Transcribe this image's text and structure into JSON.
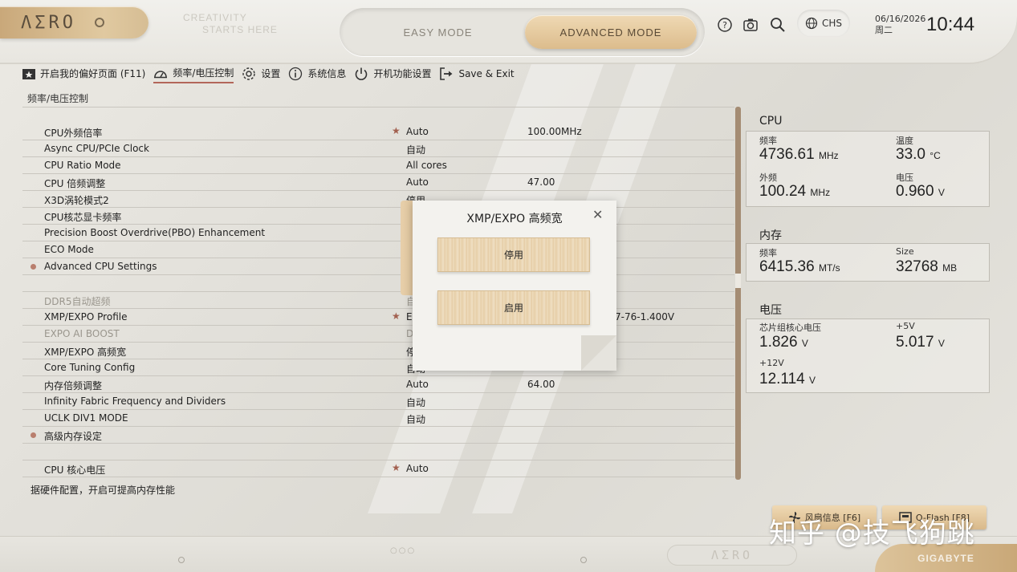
{
  "header": {
    "logo": "ΛΣRO",
    "tagline_line1": "CREATIVITY",
    "tagline_line2": "STARTS HERE",
    "easy_mode": "EASY MODE",
    "advanced_mode": "ADVANCED MODE",
    "language": "CHS",
    "date": "06/16/2026",
    "weekday": "周二",
    "time": "10:44"
  },
  "menu": {
    "favorites": "开启我的偏好页面 (F11)",
    "tweaker": "频率/电压控制",
    "settings": "设置",
    "system_info": "系统信息",
    "boot": "开机功能设置",
    "save_exit": "Save & Exit"
  },
  "breadcrumb": "频率/电压控制",
  "settings": {
    "rows": [
      {
        "name": "CPU外频倍率",
        "star": true,
        "value": "Auto",
        "value2": "100.00MHz"
      },
      {
        "name": "Async CPU/PCIe Clock",
        "value": "自动"
      },
      {
        "name": "CPU Ratio Mode",
        "value": "All cores"
      },
      {
        "name": "CPU 倍频调整",
        "value": "Auto",
        "value2": "47.00"
      },
      {
        "name": "X3D涡轮模式2",
        "value": "停用"
      },
      {
        "name": "CPU核芯显卡频率"
      },
      {
        "name": "Precision Boost Overdrive(PBO) Enhancement"
      },
      {
        "name": "ECO Mode"
      },
      {
        "name": "Advanced CPU Settings"
      },
      {
        "name": "DDR5自动超频",
        "value": "自"
      },
      {
        "name": "XMP/EXPO Profile",
        "star": true,
        "value": "EX",
        "value2": "7-76-1.400V"
      },
      {
        "name": "EXPO AI BOOST",
        "value": "D"
      },
      {
        "name": "XMP/EXPO 高频宽",
        "value": "停"
      },
      {
        "name": "Core Tuning Config",
        "value": "自动"
      },
      {
        "name": "内存倍频调整",
        "value": "Auto",
        "value2": "64.00"
      },
      {
        "name": "Infinity Fabric Frequency and Dividers",
        "value": "自动"
      },
      {
        "name": "UCLK DIV1 MODE",
        "value": "自动"
      },
      {
        "name": "高级内存设定"
      },
      {
        "name": "CPU 核心电压",
        "star": true,
        "value": "Auto"
      }
    ]
  },
  "help_text": "据硬件配置，开启可提高内存性能",
  "monitor": {
    "cpu": {
      "title": "CPU",
      "freq_label": "频率",
      "freq": "4736.61",
      "freq_unit": "MHz",
      "temp_label": "温度",
      "temp": "33.0",
      "temp_unit": "°C",
      "bclk_label": "外频",
      "bclk": "100.24",
      "bclk_unit": "MHz",
      "volt_label": "电压",
      "volt": "0.960",
      "volt_unit": "V"
    },
    "memory": {
      "title": "内存",
      "freq_label": "频率",
      "freq": "6415.36",
      "freq_unit": "MT/s",
      "size_label": "Size",
      "size": "32768",
      "size_unit": "MB"
    },
    "voltage": {
      "title": "电压",
      "chipset_label": "芯片组核心电压",
      "chipset": "1.826",
      "chipset_unit": "V",
      "p5v_label": "+5V",
      "p5v": "5.017",
      "p5v_unit": "V",
      "p12v_label": "+12V",
      "p12v": "12.114",
      "p12v_unit": "V"
    }
  },
  "modal": {
    "title": "XMP/EXPO 高频宽",
    "close": "✕",
    "option_disable": "停用",
    "option_enable": "启用"
  },
  "bottom": {
    "fan_info": "风扇信息 [F6]",
    "qflash": "Q-Flash [F8]",
    "aero": "ΛΣRO",
    "brand": "GIGABYTE",
    "watermark": "知乎 @技飞狗跳",
    "dots": "○○○"
  },
  "colors": {
    "accent_gold": "#dcbc8c",
    "accent_red": "#b3665a",
    "scroll": "#a48c73"
  }
}
